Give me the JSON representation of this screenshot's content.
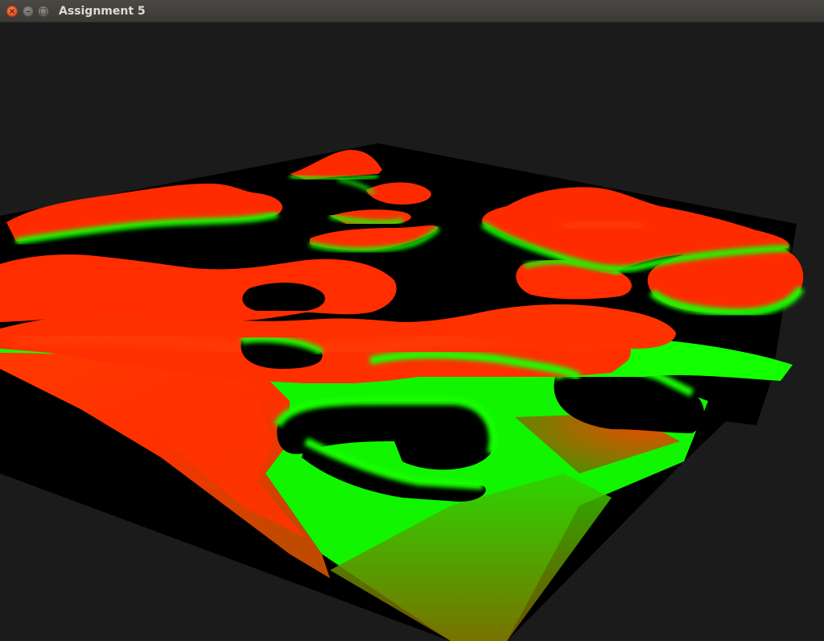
{
  "window": {
    "title": "Assignment 5",
    "close_glyph": "×",
    "minimize_glyph": "–",
    "maximize_glyph": "□",
    "close_icon": "close-icon",
    "minimize_icon": "minimize-icon",
    "maximize_icon": "maximize-icon"
  },
  "scene": {
    "background_color": "#1b1b1b",
    "floor_color": "#000000",
    "low_color": "#00ff00",
    "high_color": "#ff2200"
  }
}
